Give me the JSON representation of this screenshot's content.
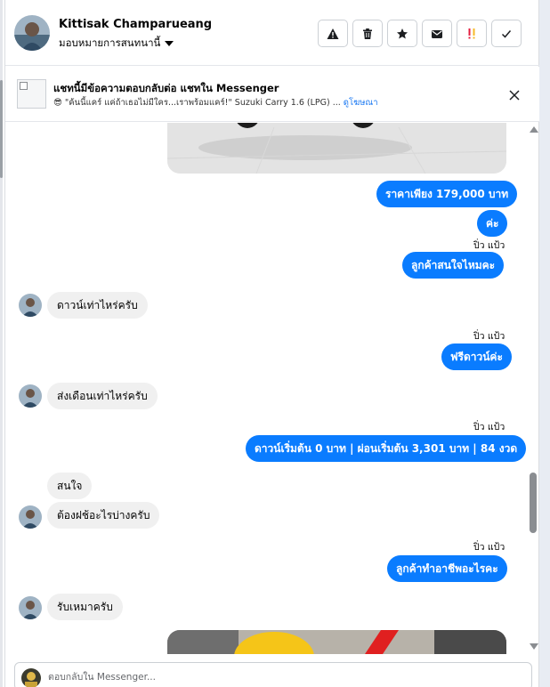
{
  "header": {
    "contact_name": "Kittisak Champarueang",
    "assign_label": "มอบหมายการสนทนานี้",
    "actions": [
      {
        "icon": "warning-icon"
      },
      {
        "icon": "trash-icon"
      },
      {
        "icon": "star-icon"
      },
      {
        "icon": "mail-icon"
      },
      {
        "icon": "important-icon"
      },
      {
        "icon": "check-icon"
      }
    ]
  },
  "banner": {
    "title": "แชทนี้มีข้อความตอบกลับต่อ แชทใน Messenger",
    "subtitle_emoji": "😎",
    "subtitle": " \"ค้นนี้แคร์ แค่ถ้าเธอไม่มีใคร...เราพร้อมแคร์!\" Suzuki Carry 1.6 (LPG) ... ",
    "subtitle_link": "ดูโฆษณา"
  },
  "messages": [
    {
      "dir": "out",
      "text": "ราคาเพียง 179,000 บาท"
    },
    {
      "dir": "out",
      "text": "ค่ะ"
    },
    {
      "dir": "sender",
      "text": "ปิ่ว แป้ว"
    },
    {
      "dir": "out",
      "text": "ลูกค้าสนใจไหมคะ"
    },
    {
      "dir": "in",
      "text": "ดาวน์เท่าไหร่ครับ"
    },
    {
      "dir": "sender",
      "text": "ปิ่ว แป้ว"
    },
    {
      "dir": "out",
      "text": "ฟรีดาวน์ค่ะ"
    },
    {
      "dir": "in",
      "text": "ส่งเดือนเท่าไหร่ครับ"
    },
    {
      "dir": "sender",
      "text": "ปิ่ว แป้ว"
    },
    {
      "dir": "out",
      "text": "ดาวน์เริ่มต้น 0 บาท | ผ่อนเริ่มต้น 3,301 บาท | 84 งวด"
    },
    {
      "dir": "in",
      "text": "สนใจ"
    },
    {
      "dir": "in",
      "text": "ต้องฝช้อะไรบ่างครับ"
    },
    {
      "dir": "sender",
      "text": "ปิ่ว แป้ว"
    },
    {
      "dir": "out",
      "text": "ลูกค้าทำอาชีพอะไรคะ"
    },
    {
      "dir": "in",
      "text": "รับเหมาครับ"
    }
  ],
  "composer": {
    "placeholder": "ตอบกลับใน Messenger..."
  },
  "colors": {
    "outgoing_bubble": "#0a7cff",
    "incoming_bubble": "#f0f0f0",
    "link": "#1877f2"
  }
}
